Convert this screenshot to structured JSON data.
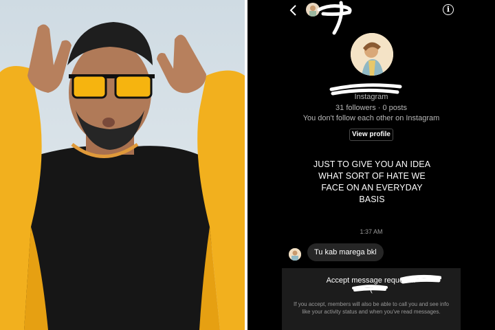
{
  "photo": {
    "colors": {
      "sky": "#c9d7df",
      "hoodie_yellow": "#f2b01e",
      "shirt_black": "#141414",
      "skin": "#b07a58",
      "lens": "#f6b40f"
    }
  },
  "chat": {
    "header": {
      "back_icon": "chevron-left-icon",
      "info_icon_glyph": "i"
    },
    "profile": {
      "subtitle": "Instagram",
      "followers": "31 followers · 0 posts",
      "follow_status": "You don't follow each other on Instagram",
      "view_profile_label": "View profile"
    },
    "shared_post": {
      "lines": [
        "JUST TO GIVE YOU AN IDEA",
        "WHAT SORT OF HATE WE",
        "FACE ON AN EVERYDAY",
        "BASIS"
      ]
    },
    "timestamp": "1:37 AM",
    "message": "Tu kab marega bkl",
    "request": {
      "title": "Accept message request fr",
      "note": "If you accept, members will also be able to call you and see info like your activity status and when you've read messages."
    },
    "colors": {
      "background": "#000000",
      "bubble": "#262626",
      "panel": "#1c1c1c",
      "muted_text": "#b8b8b8"
    }
  }
}
